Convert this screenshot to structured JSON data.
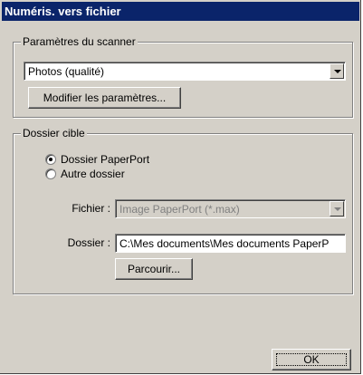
{
  "window": {
    "title": "Numéris. vers fichier"
  },
  "scanner_group": {
    "legend": "Paramètres du scanner",
    "mode_value": "Photos (qualité)",
    "modify_button": "Modifier les paramètres..."
  },
  "target_group": {
    "legend": "Dossier cible",
    "radio_paperport": "Dossier PaperPort",
    "radio_other": "Autre dossier",
    "selected": "Dossier PaperPort",
    "file_label": "Fichier :",
    "file_value": "Image PaperPort (*.max)",
    "folder_label": "Dossier :",
    "folder_value": "C:\\Mes documents\\Mes documents PaperP",
    "browse_button": "Parcourir..."
  },
  "footer": {
    "ok_button": "OK"
  }
}
